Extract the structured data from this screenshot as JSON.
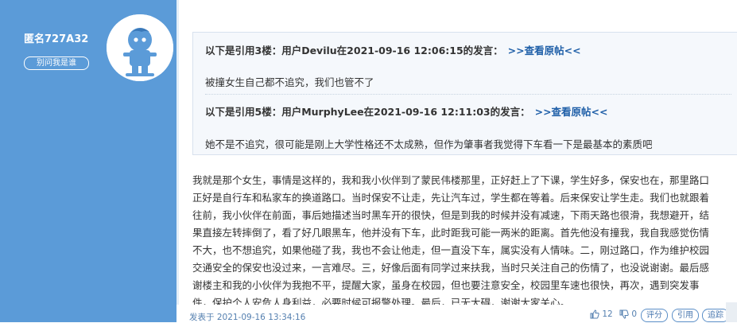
{
  "user": {
    "name": "匿名727A32",
    "whois_label": "别问我是谁"
  },
  "quotes": [
    {
      "header": "以下是引用3楼：用户Devilu在2021-09-16 12:06:15的发言：",
      "link": ">>查看原帖<<",
      "text": "被撞女生自己都不追究，我们也管不了"
    },
    {
      "header": "以下是引用5楼：用户MurphyLee在2021-09-16 12:11:03的发言：",
      "link": ">>查看原帖<<",
      "text": "她不是不追究，很可能是刚上大学性格还不太成熟，但作为肇事者我觉得下车看一下是最基本的素质吧"
    }
  ],
  "body_lines": [
    "我就是那个女生，事情是这样的，我和我小伙伴到了蒙民伟楼那里，正好赶上了下课，学生好多，保安也在，那里路口",
    "正好是自行车和私家车的换道路口。当时保安不让走，先让汽车过，学生都在等着。后来保安让学生走。我们也就跟着",
    "往前，我小伙伴在前面，事后她描述当时黑车开的很快，但是到我的时候并没有减速，下雨天路也很滑，我想避开，结",
    "果直接左转摔倒了，看了好几眼黑车，他并没有下车，此时距我可能一两米的距离。首先他没有撞我，我自我感觉伤情",
    "不大，也不想追究，如果他碰了我，我也不会让他走，但一直没下车，属实没有人情味。二，刚过路口，作为维护校园",
    "交通安全的保安也没过来，一言难尽。三，好像后面有同学过来扶我，当时只关注自己的伤情了，也没说谢谢。最后感",
    "谢楼主和我的小伙伴为我抱不平，提醒大家，虽身在校园，但也要注意安全，校园里车速也很快，再次，遇到突发事",
    "件，保护个人安危人身利益，必要时候可报警处理。最后，已无大碍，谢谢大家关心。"
  ],
  "footer": {
    "posted": "发表于 2021-09-16 13:34:16",
    "likes": "12",
    "dislikes": "0",
    "rate_label": "评分",
    "quote_label": "引用",
    "report_label": "追踪"
  }
}
